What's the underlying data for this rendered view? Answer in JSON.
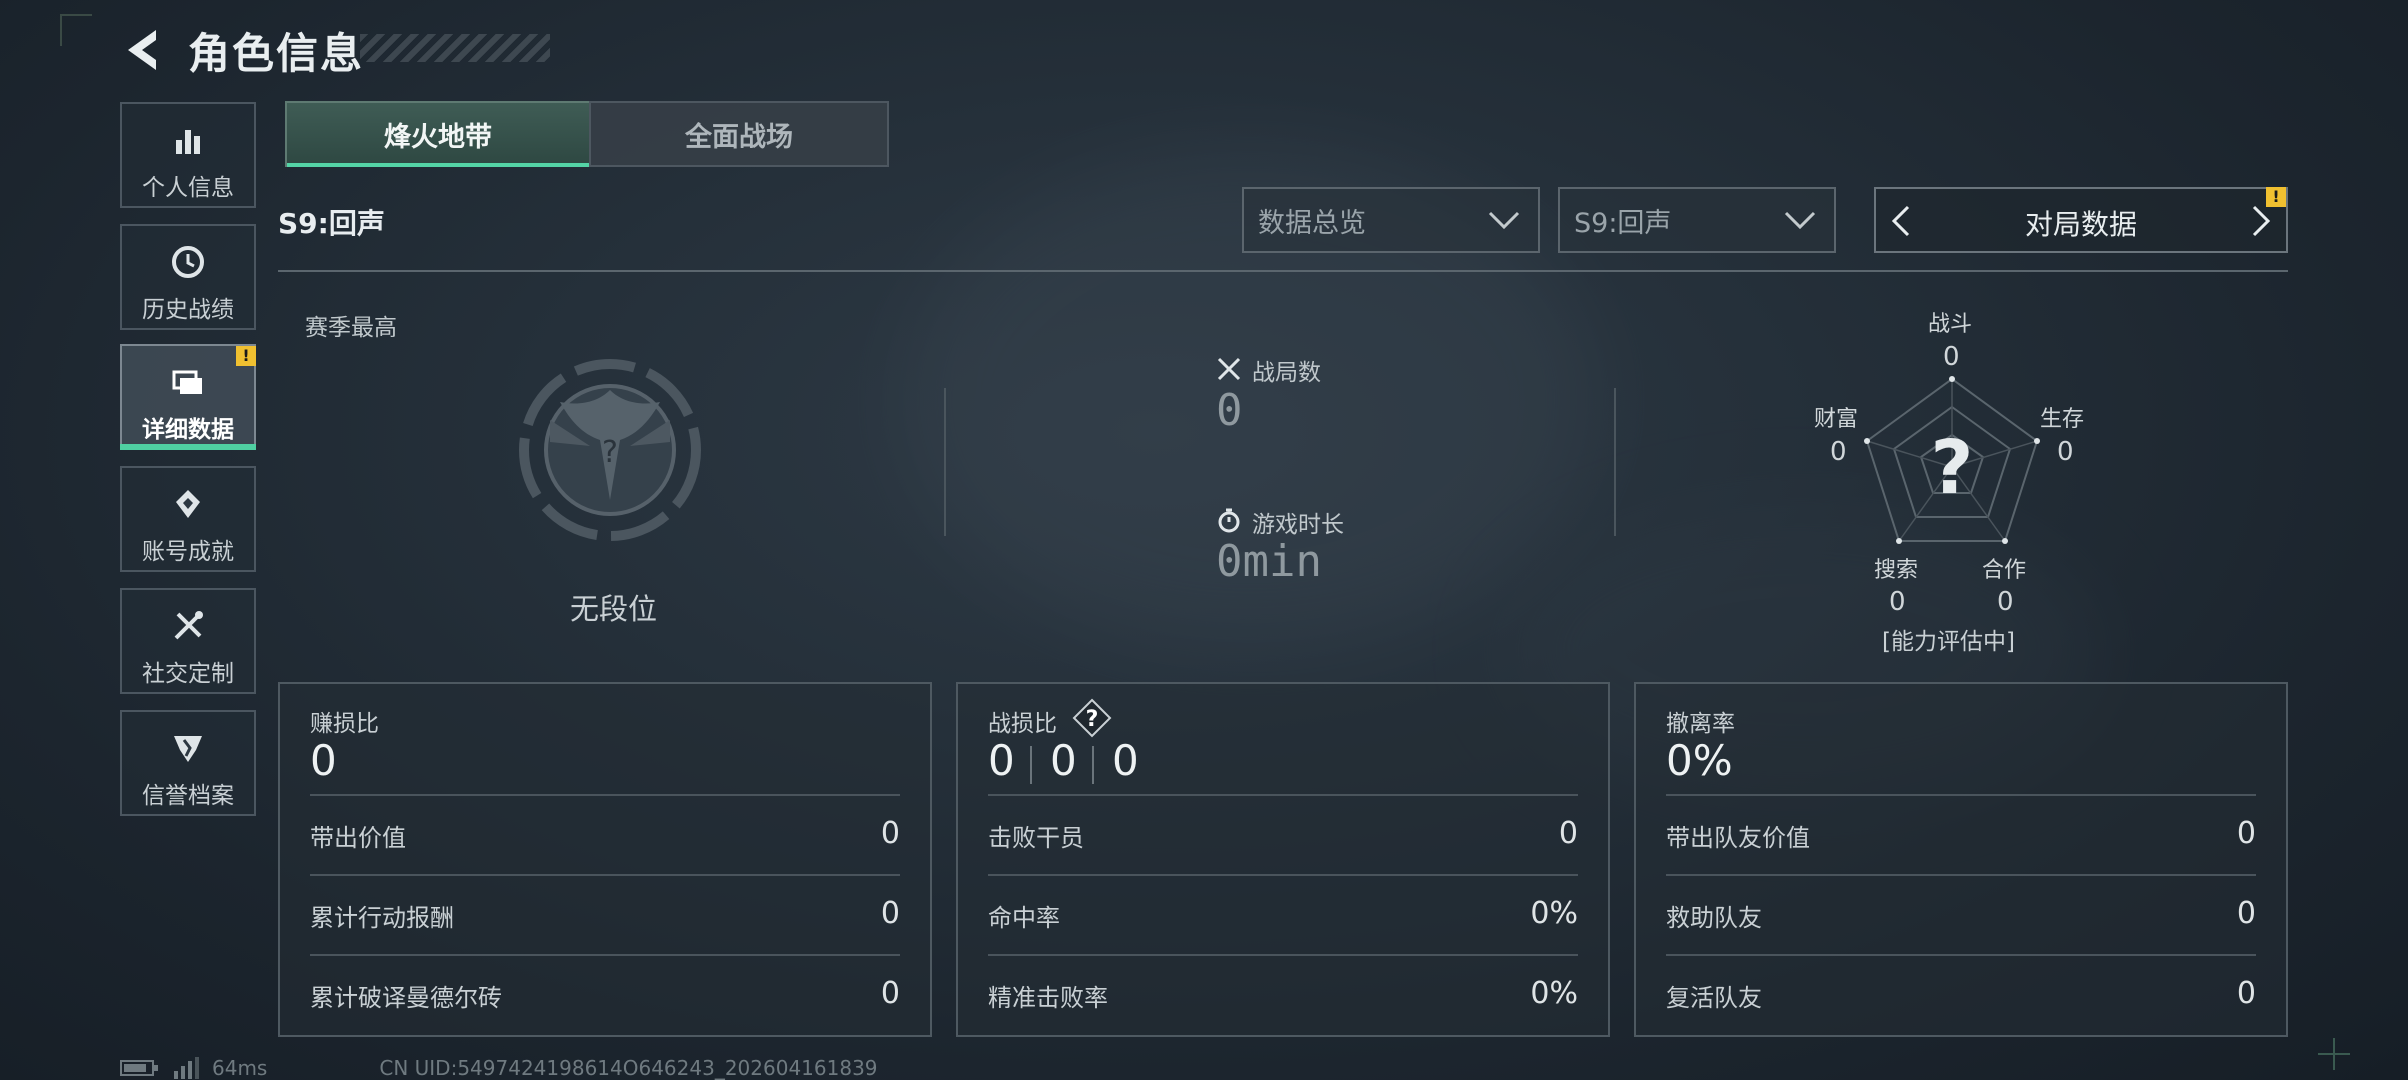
{
  "header": {
    "title": "角色信息"
  },
  "sidebar": {
    "items": [
      {
        "label": "个人信息",
        "icon": "bar-chart-icon"
      },
      {
        "label": "历史战绩",
        "icon": "clock-history-icon"
      },
      {
        "label": "详细数据",
        "icon": "folder-stack-icon",
        "active": true,
        "alert": "!"
      },
      {
        "label": "账号成就",
        "icon": "achievement-icon"
      },
      {
        "label": "社交定制",
        "icon": "tools-icon"
      },
      {
        "label": "信誉档案",
        "icon": "shield-badge-icon"
      }
    ]
  },
  "tabs": [
    {
      "label": "烽火地带",
      "active": true
    },
    {
      "label": "全面战场"
    }
  ],
  "season_label": "S9:回声",
  "filters": {
    "overview": "数据总览",
    "season": "S9:回声",
    "pager_label": "对局数据",
    "pager_alert": "!"
  },
  "rank": {
    "label": "赛季最高",
    "name": "无段位",
    "emblem_mark": "?"
  },
  "stats": {
    "matches": {
      "label": "战局数",
      "value": "0"
    },
    "playtime": {
      "label": "游戏时长",
      "value": "0min"
    }
  },
  "radar": {
    "center_mark": "?",
    "axes": [
      {
        "label": "战斗",
        "value": "0"
      },
      {
        "label": "生存",
        "value": "0"
      },
      {
        "label": "合作",
        "value": "0"
      },
      {
        "label": "搜索",
        "value": "0"
      },
      {
        "label": "财富",
        "value": "0"
      }
    ],
    "status": "[能力评估中]"
  },
  "cards": [
    {
      "title": "赚损比",
      "value": "0",
      "rows": [
        {
          "k": "带出价值",
          "v": "0"
        },
        {
          "k": "累计行动报酬",
          "v": "0"
        },
        {
          "k": "累计破译曼德尔砖",
          "v": "0"
        }
      ]
    },
    {
      "title": "战损比",
      "help": "?",
      "kd": [
        "0",
        "0",
        "0"
      ],
      "rows": [
        {
          "k": "击败干员",
          "v": "0"
        },
        {
          "k": "命中率",
          "v": "0%"
        },
        {
          "k": "精准击败率",
          "v": "0%"
        }
      ]
    },
    {
      "title": "撤离率",
      "value": "0%",
      "rows": [
        {
          "k": "带出队友价值",
          "v": "0"
        },
        {
          "k": "救助队友",
          "v": "0"
        },
        {
          "k": "复活队友",
          "v": "0"
        }
      ]
    }
  ],
  "footer": {
    "ping": "64ms",
    "uid": "CN UID:5497424198614O646243_202604161839"
  },
  "colors": {
    "accent": "#54d4a6",
    "warning": "#f0c030"
  }
}
